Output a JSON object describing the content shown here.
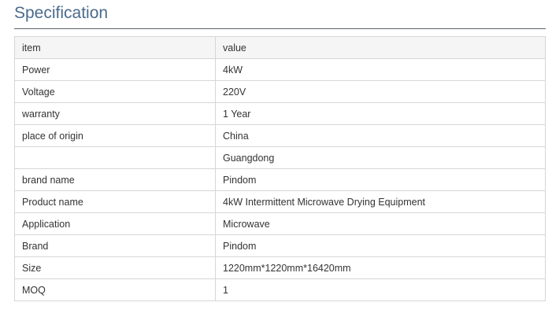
{
  "page": {
    "title": "Specification"
  },
  "table": {
    "headers": [
      "item",
      "value"
    ],
    "rows": [
      [
        "Power",
        "4kW"
      ],
      [
        "Voltage",
        "220V"
      ],
      [
        "warranty",
        "1 Year"
      ],
      [
        "place of origin",
        "China"
      ],
      [
        "",
        "Guangdong"
      ],
      [
        "brand name",
        "Pindom"
      ],
      [
        "Product name",
        "4kW Intermittent Microwave Drying Equipment"
      ],
      [
        "Application",
        "Microwave"
      ],
      [
        "Brand",
        "Pindom"
      ],
      [
        "Size",
        "1220mm*1220mm*16420mm"
      ],
      [
        "MOQ",
        "1"
      ]
    ]
  }
}
